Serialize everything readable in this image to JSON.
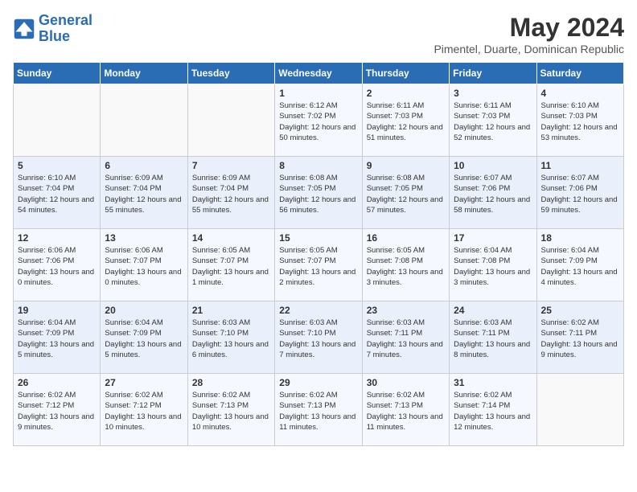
{
  "header": {
    "logo_line1": "General",
    "logo_line2": "Blue",
    "month": "May 2024",
    "location": "Pimentel, Duarte, Dominican Republic"
  },
  "weekdays": [
    "Sunday",
    "Monday",
    "Tuesday",
    "Wednesday",
    "Thursday",
    "Friday",
    "Saturday"
  ],
  "weeks": [
    [
      {
        "day": "",
        "info": ""
      },
      {
        "day": "",
        "info": ""
      },
      {
        "day": "",
        "info": ""
      },
      {
        "day": "1",
        "info": "Sunrise: 6:12 AM\nSunset: 7:02 PM\nDaylight: 12 hours\nand 50 minutes."
      },
      {
        "day": "2",
        "info": "Sunrise: 6:11 AM\nSunset: 7:03 PM\nDaylight: 12 hours\nand 51 minutes."
      },
      {
        "day": "3",
        "info": "Sunrise: 6:11 AM\nSunset: 7:03 PM\nDaylight: 12 hours\nand 52 minutes."
      },
      {
        "day": "4",
        "info": "Sunrise: 6:10 AM\nSunset: 7:03 PM\nDaylight: 12 hours\nand 53 minutes."
      }
    ],
    [
      {
        "day": "5",
        "info": "Sunrise: 6:10 AM\nSunset: 7:04 PM\nDaylight: 12 hours\nand 54 minutes."
      },
      {
        "day": "6",
        "info": "Sunrise: 6:09 AM\nSunset: 7:04 PM\nDaylight: 12 hours\nand 55 minutes."
      },
      {
        "day": "7",
        "info": "Sunrise: 6:09 AM\nSunset: 7:04 PM\nDaylight: 12 hours\nand 55 minutes."
      },
      {
        "day": "8",
        "info": "Sunrise: 6:08 AM\nSunset: 7:05 PM\nDaylight: 12 hours\nand 56 minutes."
      },
      {
        "day": "9",
        "info": "Sunrise: 6:08 AM\nSunset: 7:05 PM\nDaylight: 12 hours\nand 57 minutes."
      },
      {
        "day": "10",
        "info": "Sunrise: 6:07 AM\nSunset: 7:06 PM\nDaylight: 12 hours\nand 58 minutes."
      },
      {
        "day": "11",
        "info": "Sunrise: 6:07 AM\nSunset: 7:06 PM\nDaylight: 12 hours\nand 59 minutes."
      }
    ],
    [
      {
        "day": "12",
        "info": "Sunrise: 6:06 AM\nSunset: 7:06 PM\nDaylight: 13 hours\nand 0 minutes."
      },
      {
        "day": "13",
        "info": "Sunrise: 6:06 AM\nSunset: 7:07 PM\nDaylight: 13 hours\nand 0 minutes."
      },
      {
        "day": "14",
        "info": "Sunrise: 6:05 AM\nSunset: 7:07 PM\nDaylight: 13 hours\nand 1 minute."
      },
      {
        "day": "15",
        "info": "Sunrise: 6:05 AM\nSunset: 7:07 PM\nDaylight: 13 hours\nand 2 minutes."
      },
      {
        "day": "16",
        "info": "Sunrise: 6:05 AM\nSunset: 7:08 PM\nDaylight: 13 hours\nand 3 minutes."
      },
      {
        "day": "17",
        "info": "Sunrise: 6:04 AM\nSunset: 7:08 PM\nDaylight: 13 hours\nand 3 minutes."
      },
      {
        "day": "18",
        "info": "Sunrise: 6:04 AM\nSunset: 7:09 PM\nDaylight: 13 hours\nand 4 minutes."
      }
    ],
    [
      {
        "day": "19",
        "info": "Sunrise: 6:04 AM\nSunset: 7:09 PM\nDaylight: 13 hours\nand 5 minutes."
      },
      {
        "day": "20",
        "info": "Sunrise: 6:04 AM\nSunset: 7:09 PM\nDaylight: 13 hours\nand 5 minutes."
      },
      {
        "day": "21",
        "info": "Sunrise: 6:03 AM\nSunset: 7:10 PM\nDaylight: 13 hours\nand 6 minutes."
      },
      {
        "day": "22",
        "info": "Sunrise: 6:03 AM\nSunset: 7:10 PM\nDaylight: 13 hours\nand 7 minutes."
      },
      {
        "day": "23",
        "info": "Sunrise: 6:03 AM\nSunset: 7:11 PM\nDaylight: 13 hours\nand 7 minutes."
      },
      {
        "day": "24",
        "info": "Sunrise: 6:03 AM\nSunset: 7:11 PM\nDaylight: 13 hours\nand 8 minutes."
      },
      {
        "day": "25",
        "info": "Sunrise: 6:02 AM\nSunset: 7:11 PM\nDaylight: 13 hours\nand 9 minutes."
      }
    ],
    [
      {
        "day": "26",
        "info": "Sunrise: 6:02 AM\nSunset: 7:12 PM\nDaylight: 13 hours\nand 9 minutes."
      },
      {
        "day": "27",
        "info": "Sunrise: 6:02 AM\nSunset: 7:12 PM\nDaylight: 13 hours\nand 10 minutes."
      },
      {
        "day": "28",
        "info": "Sunrise: 6:02 AM\nSunset: 7:13 PM\nDaylight: 13 hours\nand 10 minutes."
      },
      {
        "day": "29",
        "info": "Sunrise: 6:02 AM\nSunset: 7:13 PM\nDaylight: 13 hours\nand 11 minutes."
      },
      {
        "day": "30",
        "info": "Sunrise: 6:02 AM\nSunset: 7:13 PM\nDaylight: 13 hours\nand 11 minutes."
      },
      {
        "day": "31",
        "info": "Sunrise: 6:02 AM\nSunset: 7:14 PM\nDaylight: 13 hours\nand 12 minutes."
      },
      {
        "day": "",
        "info": ""
      }
    ]
  ]
}
